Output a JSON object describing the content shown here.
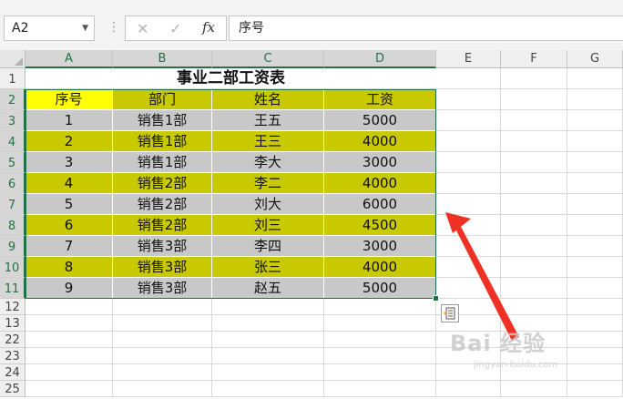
{
  "formula_bar": {
    "name_box": "A2",
    "cancel_icon": "✕",
    "enter_icon": "✓",
    "function_icon": "fx",
    "content": "序号"
  },
  "columns": [
    "A",
    "B",
    "C",
    "D",
    "E",
    "F",
    "G"
  ],
  "rows": [
    "1",
    "2",
    "3",
    "4",
    "5",
    "6",
    "7",
    "8",
    "9",
    "10",
    "11",
    "12",
    "13",
    "22",
    "23",
    "24",
    "25"
  ],
  "sheet": {
    "title": "事业二部工资表",
    "headers": [
      "序号",
      "部门",
      "姓名",
      "工资"
    ],
    "records": [
      [
        "1",
        "销售1部",
        "王五",
        "5000"
      ],
      [
        "2",
        "销售1部",
        "王三",
        "4000"
      ],
      [
        "3",
        "销售1部",
        "李大",
        "3000"
      ],
      [
        "4",
        "销售2部",
        "李二",
        "4000"
      ],
      [
        "5",
        "销售2部",
        "刘大",
        "6000"
      ],
      [
        "6",
        "销售2部",
        "刘三",
        "4500"
      ],
      [
        "7",
        "销售3部",
        "李四",
        "3000"
      ],
      [
        "8",
        "销售3部",
        "张三",
        "4000"
      ],
      [
        "9",
        "销售3部",
        "赵五",
        "5000"
      ]
    ]
  },
  "colors": {
    "header_highlight": "#ffff00",
    "header_fill": "#c9c900",
    "odd_row_fill": "#c8c8c8",
    "even_row_fill": "#c9c900",
    "selection_green": "#217346",
    "arrow_red": "#ee3124"
  },
  "watermark": {
    "text": "Bai 经验",
    "sub": "jingyan.baidu.com"
  }
}
